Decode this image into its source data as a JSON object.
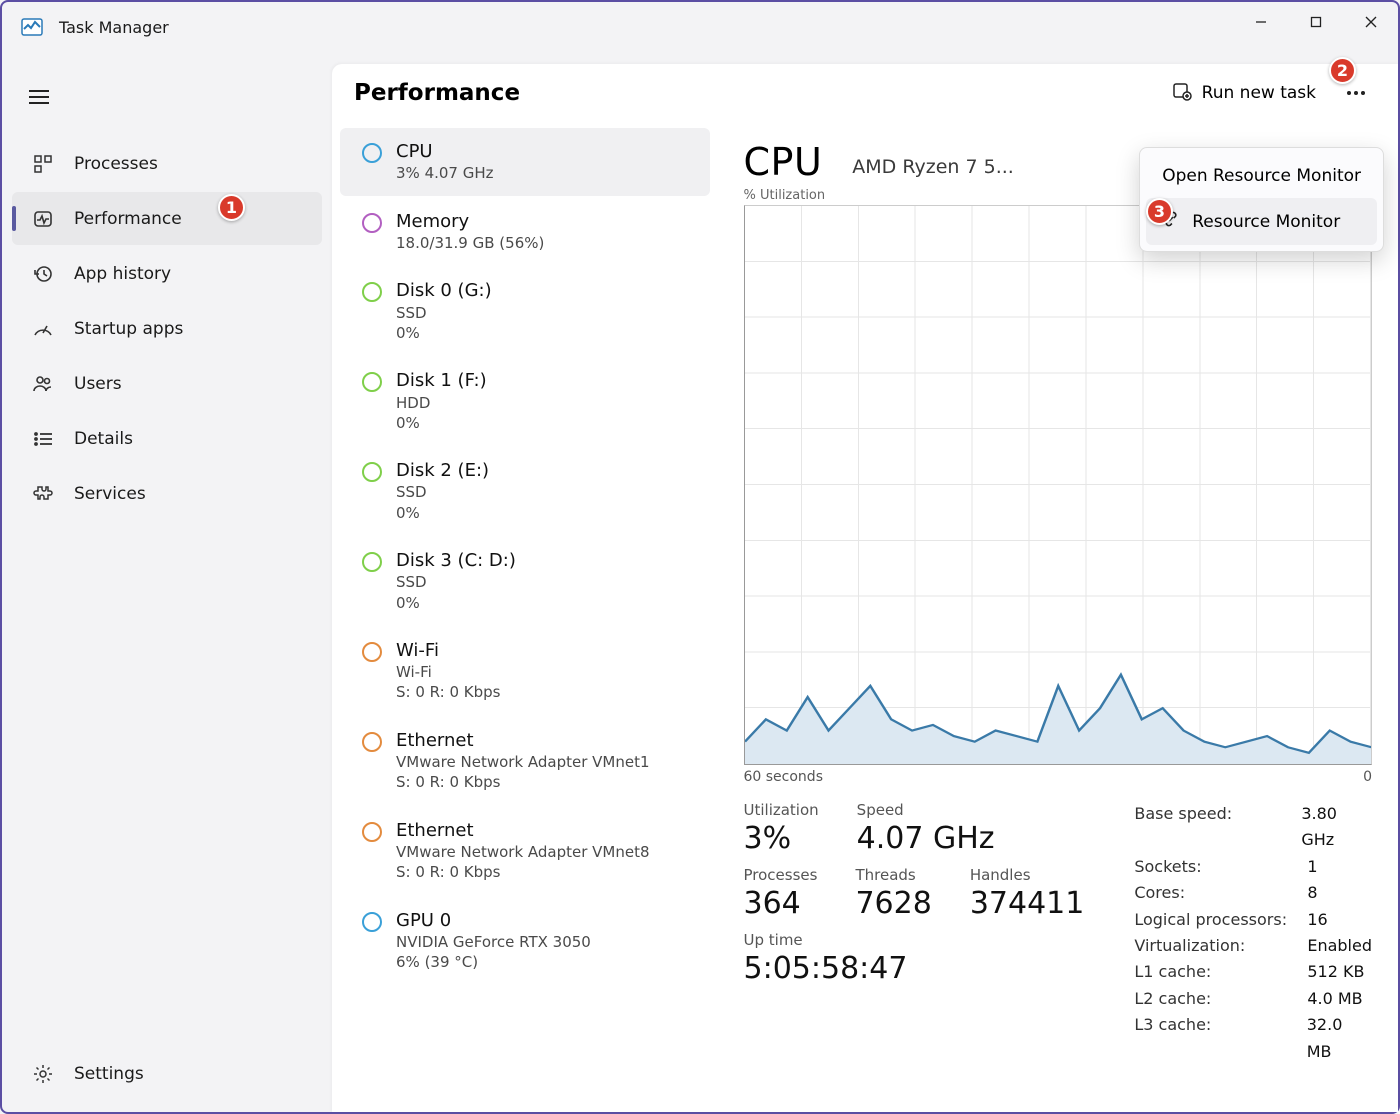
{
  "window": {
    "title": "Task Manager"
  },
  "sidebar": {
    "items": [
      {
        "label": "Processes"
      },
      {
        "label": "Performance"
      },
      {
        "label": "App history"
      },
      {
        "label": "Startup apps"
      },
      {
        "label": "Users"
      },
      {
        "label": "Details"
      },
      {
        "label": "Services"
      }
    ],
    "settings_label": "Settings"
  },
  "header": {
    "title": "Performance",
    "run_new_task": "Run new task"
  },
  "menu": {
    "items": [
      {
        "label": "Open Resource Monitor"
      },
      {
        "label": "Resource Monitor"
      }
    ]
  },
  "resources": [
    {
      "name": "CPU",
      "sub1": "3%  4.07 GHz",
      "color": "#3aa0d8"
    },
    {
      "name": "Memory",
      "sub1": "18.0/31.9 GB (56%)",
      "color": "#b25fc1"
    },
    {
      "name": "Disk 0 (G:)",
      "sub1": "SSD",
      "sub2": "0%",
      "color": "#7fcf4a"
    },
    {
      "name": "Disk 1 (F:)",
      "sub1": "HDD",
      "sub2": "0%",
      "color": "#7fcf4a"
    },
    {
      "name": "Disk 2 (E:)",
      "sub1": "SSD",
      "sub2": "0%",
      "color": "#7fcf4a"
    },
    {
      "name": "Disk 3 (C: D:)",
      "sub1": "SSD",
      "sub2": "0%",
      "color": "#7fcf4a"
    },
    {
      "name": "Wi-Fi",
      "sub1": "Wi-Fi",
      "sub2": "S: 0  R: 0 Kbps",
      "color": "#e38b3e"
    },
    {
      "name": "Ethernet",
      "sub1": "VMware Network Adapter VMnet1",
      "sub2": "S: 0  R: 0 Kbps",
      "color": "#e38b3e"
    },
    {
      "name": "Ethernet",
      "sub1": "VMware Network Adapter VMnet8",
      "sub2": "S: 0  R: 0 Kbps",
      "color": "#e38b3e"
    },
    {
      "name": "GPU 0",
      "sub1": "NVIDIA GeForce RTX 3050",
      "sub2": "6%  (39 °C)",
      "color": "#3aa0d8"
    }
  ],
  "detail": {
    "name": "CPU",
    "model": "AMD Ryzen 7 5...",
    "util_label": "% Utilization",
    "x_left": "60 seconds",
    "x_right": "0",
    "stats": {
      "utilization_l": "Utilization",
      "utilization_v": "3%",
      "speed_l": "Speed",
      "speed_v": "4.07 GHz",
      "processes_l": "Processes",
      "processes_v": "364",
      "threads_l": "Threads",
      "threads_v": "7628",
      "handles_l": "Handles",
      "handles_v": "374411",
      "uptime_l": "Up time",
      "uptime_v": "5:05:58:47"
    },
    "info": [
      {
        "k": "Base speed:",
        "v": "3.80 GHz"
      },
      {
        "k": "Sockets:",
        "v": "1"
      },
      {
        "k": "Cores:",
        "v": "8"
      },
      {
        "k": "Logical processors:",
        "v": "16"
      },
      {
        "k": "Virtualization:",
        "v": "Enabled"
      },
      {
        "k": "L1 cache:",
        "v": "512 KB"
      },
      {
        "k": "L2 cache:",
        "v": "4.0 MB"
      },
      {
        "k": "L3 cache:",
        "v": "32.0 MB"
      }
    ]
  },
  "annotations": {
    "b1": "1",
    "b2": "2",
    "b3": "3"
  },
  "chart_data": {
    "type": "area",
    "title": "% Utilization",
    "xlabel": "seconds",
    "ylabel": "% Utilization",
    "ylim": [
      0,
      100
    ],
    "x_seconds": [
      60,
      58,
      56,
      54,
      52,
      50,
      48,
      46,
      44,
      42,
      40,
      38,
      36,
      34,
      32,
      30,
      28,
      26,
      24,
      22,
      20,
      18,
      16,
      14,
      12,
      10,
      8,
      6,
      4,
      2,
      0
    ],
    "values": [
      4,
      8,
      6,
      12,
      6,
      10,
      14,
      8,
      6,
      7,
      5,
      4,
      6,
      5,
      4,
      14,
      6,
      10,
      16,
      8,
      10,
      6,
      4,
      3,
      4,
      5,
      3,
      2,
      6,
      4,
      3
    ]
  }
}
